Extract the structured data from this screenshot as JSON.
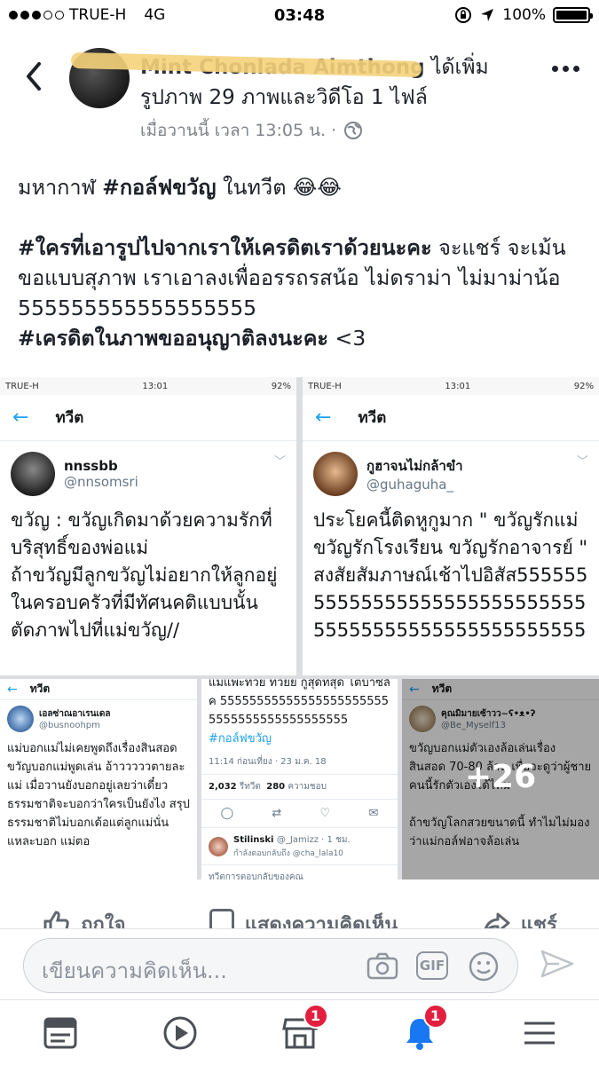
{
  "status_bar": {
    "carrier": "TRUE-H",
    "network": "4G",
    "time": "03:48",
    "battery": "100%",
    "battery_level": 1.0,
    "signal_bars_filled": 3,
    "signal_bars_total": 5
  },
  "header": {
    "author_name": "Mint Chonlada Aimthong",
    "action": "ได้เพิ่ม",
    "summary": "รูปภาพ 29 ภาพและวิดีโอ 1 ไฟล์",
    "timestamp": "เมื่อวานนี้ เวลา 13:05 น. ·"
  },
  "post": {
    "line1_text": "มหากาฬ ",
    "line1_tag": "#กอล์ฟขวัญ",
    "line1_rest": " ในทวีต 😂😂",
    "para2_tag": "#ใครที่เอารูปไปจากเราให้เครดิตเราด้วยนะคะ",
    "para2_text": " จะแชร์ จะเม้นขอแบบสุภาพ เราเอาลงเพื่ออรรถรสน้อ ไม่ดราม่า ไม่มาม่าน้อ 555555555555555555",
    "para3_tag": "#เครดิตในภาพขออนุญาติลงนะคะ",
    "para3_text": " <3"
  },
  "photos": {
    "shot1": {
      "carrier": "TRUE-H",
      "time": "13:01",
      "battery": "92%",
      "title": "ทวีต",
      "name": "nnssbb",
      "handle": "@nnsomsri",
      "body": "ขวัญ : ขวัญเกิดมาด้วยความรักที่บริสุทธิ์ของพ่อแม่\nถ้าขวัญมีลูกขวัญไม่อยากให้ลูกอยู่ในครอบครัวที่มีทัศนคติแบบนั้น\nตัดภาพไปที่แม่ขวัญ//"
    },
    "shot2": {
      "carrier": "TRUE-H",
      "time": "13:01",
      "battery": "92%",
      "title": "ทวีต",
      "name": "กูฮาจนไม่กล้าขำ",
      "handle": "@guhaguha_",
      "body": "ประโยคนี้ติดหูกูมาก \" ขวัญรักแม่ ขวัญรักโรงเรียน ขวัญรักอาจารย์ \" สงสัยสัมภาษณ์เช้าไปอิสัส5555555555555555555555555555555555555555555555555555"
    },
    "shot3": {
      "title": "ทวีต",
      "name": "เอลซ่าณอาเรนเดล",
      "handle": "@busnoohpm",
      "body": "แม่บอกแม่ไม่เคยพูดถึงเรื่องสินสอด ขวัญบอกแม่พูดเล่น อ้าวววววตายละแม่ เมื่อวานยังบอกอยู่เลยว่าเดี๋ยวธรรมชาติจะบอกว่าใครเป็นยังไง สรุปธรรมชาติไม่บอกเด้อแต่ลูกแม่นั่นแหละบอก แม่ตอ"
    },
    "shot4": {
      "body_top": "แมแพะทวย ทวยย กูสุดทสุด โตบาซิลัค 555555555555555555555555555555555555555555",
      "tag": "#กอล์ฟขวัญ",
      "meta": "11:14 ก่อนเที่ยง · 23 ม.ค. 18",
      "retweets": "2,032",
      "retweets_label": "รีทวีต",
      "likes": "280",
      "likes_label": "ความชอบ",
      "reply_name": "Stilinski",
      "reply_handle": "@_Jamizz · 1 ชม.",
      "reply_to": "กำลังตอบกลับถึง @cha_lala10",
      "reply_placeholder": "ทวีตการตอบกลับของคุณ"
    },
    "shot5": {
      "title": "ทวีต",
      "name": "คุณมิมายเซ้าวว~ʕ•ᴥ•ʔ",
      "handle": "@Be_Myself13",
      "body": "ขวัญบอกแม่ตัวเองล้อเล่นเรื่องสินสอด 70-80 ล้าน เพื่อจะดูว่าผู้ชายคนนี้รักตัวเองได้ไหม\n\nถ้าขวัญโลกสวยขนาดนี้ ทำไมไม่มองว่าแม่กอล์ฟอาจล้อเล่น",
      "more_count": "+26"
    }
  },
  "actions": {
    "like": "ถูกใจ",
    "comment": "แสดงความคิดเห็น",
    "share": "แชร์"
  },
  "composer": {
    "placeholder": "เขียนความคิดเห็น..."
  },
  "tabbar": {
    "marketplace_badge": "1",
    "notifications_badge": "1"
  },
  "colors": {
    "twitter_blue": "#1da1f2",
    "badge_red": "#e41e3f",
    "highlighter": "#f5d27a"
  }
}
